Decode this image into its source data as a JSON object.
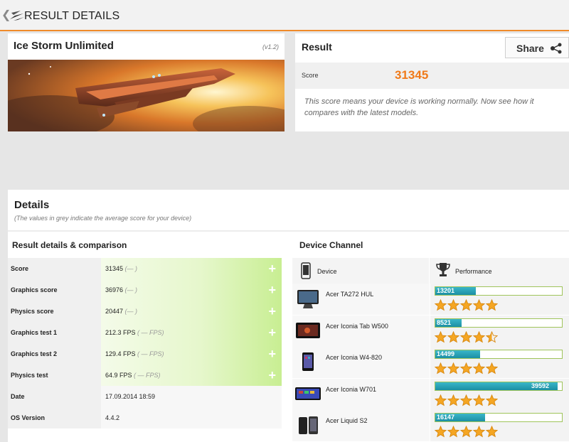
{
  "header": {
    "title": "RESULT DETAILS",
    "back_glyph": "❮"
  },
  "test": {
    "name": "Ice Storm Unlimited",
    "version": "(v1.2)"
  },
  "result": {
    "title": "Result",
    "share_label": "Share",
    "score_label": "Score",
    "score_value": "31345",
    "description": "This score means your device is working normally. Now see how it compares with the latest models."
  },
  "details": {
    "title": "Details",
    "note": "(The values in grey indicate the average score for your device)",
    "comparison_title": "Result details & comparison",
    "rows": [
      {
        "label": "Score",
        "value": "31345",
        "avg": "(— )",
        "expandable": true
      },
      {
        "label": "Graphics score",
        "value": "36976",
        "avg": "(— )",
        "expandable": true
      },
      {
        "label": "Physics score",
        "value": "20447",
        "avg": "(— )",
        "expandable": true
      },
      {
        "label": "Graphics test 1",
        "value": "212.3 FPS",
        "avg": "( — FPS)",
        "expandable": true
      },
      {
        "label": "Graphics test 2",
        "value": "129.4 FPS",
        "avg": "( — FPS)",
        "expandable": true
      },
      {
        "label": "Physics test",
        "value": "64.9 FPS",
        "avg": "( — FPS)",
        "expandable": true
      },
      {
        "label": "Date",
        "value": "17.09.2014 18:59",
        "avg": "",
        "expandable": false
      },
      {
        "label": "OS Version",
        "value": "4.4.2",
        "avg": "",
        "expandable": false
      }
    ]
  },
  "channel": {
    "title": "Device Channel",
    "col_device": "Device",
    "col_performance": "Performance",
    "max_score": 41000,
    "devices": [
      {
        "name": "Acer TA272 HUL",
        "score": 13201,
        "score_text": "13201",
        "stars": 5,
        "icon": "monitor-icon"
      },
      {
        "name": "Acer Iconia Tab W500",
        "score": 8521,
        "score_text": "8521",
        "stars": 4.5,
        "icon": "tablet-dock-icon"
      },
      {
        "name": "Acer Iconia W4-820",
        "score": 14499,
        "score_text": "14499",
        "stars": 5,
        "icon": "tablet-icon"
      },
      {
        "name": "Acer Iconia W701",
        "score": 39592,
        "score_text": "39592",
        "stars": 5,
        "icon": "widescreen-tablet-icon"
      },
      {
        "name": "Acer Liquid S2",
        "score": 16147,
        "score_text": "16147",
        "stars": 5,
        "icon": "phone-icon"
      }
    ]
  },
  "colors": {
    "accent": "#f08a2a",
    "score": "#f07a1a",
    "bar": "#1c8fa4",
    "star": "#f5a623"
  }
}
